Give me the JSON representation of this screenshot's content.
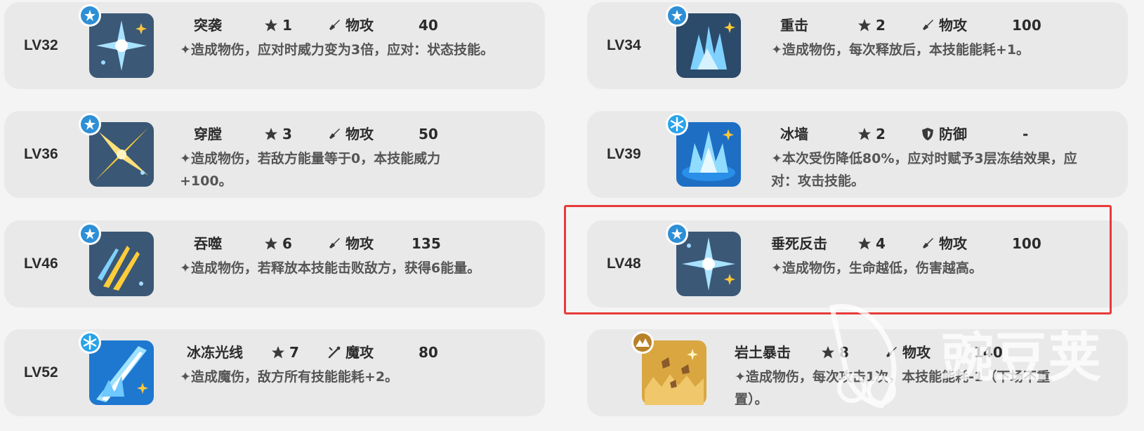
{
  "cards": [
    {
      "level": "LV32",
      "name": "突袭",
      "cost": "1",
      "type_icon": "sword-icon",
      "type": "物攻",
      "power": "40",
      "badge_icon": "star-badge-icon",
      "icon": "sparkle-skill-icon",
      "desc": "✦造成物伤，应对时威力变为3倍，应对：状态技能。"
    },
    {
      "level": "LV34",
      "name": "重击",
      "cost": "2",
      "type_icon": "sword-icon",
      "type": "物攻",
      "power": "100",
      "badge_icon": "star-badge-icon",
      "icon": "impact-skill-icon",
      "desc": "✦造成物伤，每次释放后，本技能能耗+1。"
    },
    {
      "level": "LV36",
      "name": "穿膛",
      "cost": "3",
      "type_icon": "sword-icon",
      "type": "物攻",
      "power": "50",
      "badge_icon": "star-badge-icon",
      "icon": "slash-skill-icon",
      "desc": "✦造成物伤，若敌方能量等于0，本技能威力+100。"
    },
    {
      "level": "LV39",
      "name": "冰墙",
      "cost": "2",
      "type_icon": "shield-icon",
      "type": "防御",
      "power": "-",
      "badge_icon": "snowflake-badge-icon",
      "icon": "ice-wall-skill-icon",
      "desc": "✦本次受伤降低80%，应对时赋予3层冻结效果，应对：攻击技能。"
    },
    {
      "level": "LV46",
      "name": "吞噬",
      "cost": "6",
      "type_icon": "sword-icon",
      "type": "物攻",
      "power": "135",
      "badge_icon": "star-badge-icon",
      "icon": "claw-skill-icon",
      "desc": "✦造成物伤，若释放本技能击败敌方，获得6能量。"
    },
    {
      "level": "LV48",
      "name": "垂死反击",
      "cost": "4",
      "type_icon": "sword-icon",
      "type": "物攻",
      "power": "100",
      "badge_icon": "star-badge-icon",
      "icon": "sparkle-skill-icon",
      "desc": "✦造成物伤，生命越低，伤害越高。"
    },
    {
      "level": "LV52",
      "name": "冰冻光线",
      "cost": "7",
      "type_icon": "wand-icon",
      "type": "魔攻",
      "power": "80",
      "badge_icon": "snowflake-badge-icon",
      "icon": "ice-beam-skill-icon",
      "desc": "✦造成魔伤，敌方所有技能能耗+2。"
    },
    {
      "level": "",
      "name": "岩土暴击",
      "cost": "8",
      "type_icon": "sword-icon",
      "type": "物攻",
      "power": "140",
      "badge_icon": "mountain-badge-icon",
      "icon": "rock-skill-icon",
      "desc": "✦造成物伤，每次攻击1次，本技能能耗-1（下场不重置）。"
    }
  ],
  "watermark_text": "豌豆荚",
  "colors": {
    "highlight": "#e83a3a",
    "card_bg": "#e9e9e9",
    "badge_blue": "#2d8fd6",
    "badge_gold": "#b8822a"
  }
}
